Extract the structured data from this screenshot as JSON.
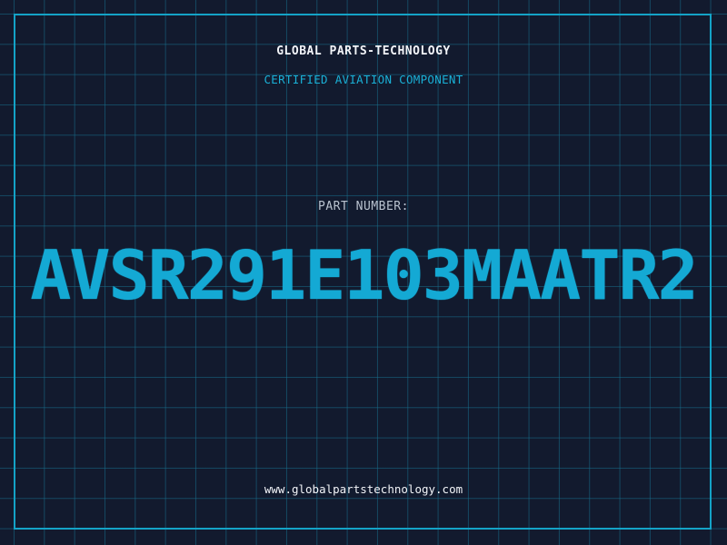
{
  "header": {
    "company": "GLOBAL PARTS-TECHNOLOGY",
    "subtitle": "CERTIFIED AVIATION COMPONENT"
  },
  "main": {
    "part_label": "PART NUMBER:",
    "part_number": "AVSR291E103MAATR2"
  },
  "footer": {
    "website": "www.globalpartstechnology.com"
  },
  "colors": {
    "background": "#121a2e",
    "grid": "#176e8c",
    "accent": "#14a9d4",
    "text": "#f2f4f8"
  }
}
